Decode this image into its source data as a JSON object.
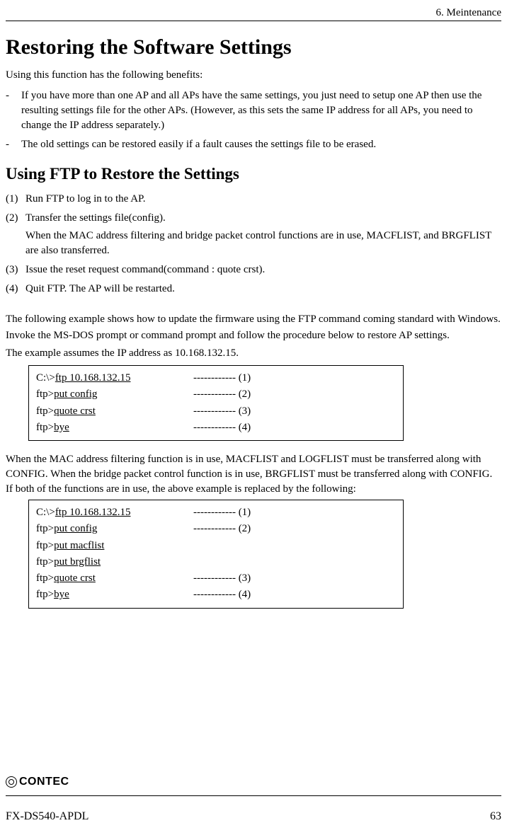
{
  "header": {
    "chapter": "6. Meintenance"
  },
  "title": "Restoring the Software Settings",
  "intro": "Using this function has the following benefits:",
  "bullets": [
    "If you have more than one AP and all APs have the same settings, you just need to setup one AP then use the resulting settings file for the other APs.  (However, as this sets the same IP address for all APs, you need to change the IP address separately.)",
    " The old settings can be restored easily if a fault causes the settings file to be erased."
  ],
  "subtitle": "Using FTP to Restore the Settings",
  "steps": [
    {
      "n": "(1)",
      "text": "Run FTP to log in to the AP."
    },
    {
      "n": "(2)",
      "text": "Transfer the settings file(config).",
      "sub": "When the MAC address filtering and bridge packet control functions are in use, MACFLIST, and BRGFLIST are also transferred."
    },
    {
      "n": "(3)",
      "text": "Issue the reset request command(command : quote crst)."
    },
    {
      "n": "(4)",
      "text": "Quit FTP.  The AP will be restarted."
    }
  ],
  "para1a": "The following example shows how to update the firmware using the FTP command coming standard with Windows.",
  "para1b": "Invoke the MS-DOS prompt or command prompt and follow the procedure below to restore AP settings.",
  "para1c": "The example assumes the IP address as 10.168.132.15.",
  "code1": [
    {
      "prompt": "C:\\>",
      "cmd": "ftp 10.168.132.15",
      "ann": "------------ (1)"
    },
    {
      "prompt": "ftp>",
      "cmd": "put config",
      "ann": "------------ (2)"
    },
    {
      "prompt": "ftp>",
      "cmd": "quote crst",
      "ann": "------------ (3)"
    },
    {
      "prompt": "ftp>",
      "cmd": "bye",
      "ann": "------------ (4)"
    }
  ],
  "between": "When the MAC address filtering function is in use, MACFLIST and LOGFLIST must be transferred along with CONFIG.  When the bridge packet control function is in use, BRGFLIST must be transferred along with CONFIG.  If both of the functions are in use, the above example is replaced by the following:",
  "code2": [
    {
      "prompt": "C:\\>",
      "cmd": "ftp 10.168.132.15",
      "ann": "------------ (1)"
    },
    {
      "prompt": "ftp>",
      "cmd": "put config",
      "ann": "------------ (2)"
    },
    {
      "prompt": "ftp>",
      "cmd": "put macflist",
      "ann": ""
    },
    {
      "prompt": "ftp>",
      "cmd": "put brgflist",
      "ann": ""
    },
    {
      "prompt": "ftp>",
      "cmd": "quote crst",
      "ann": "------------ (3)"
    },
    {
      "prompt": "ftp>",
      "cmd": "bye",
      "ann": "------------ (4)"
    }
  ],
  "footer": {
    "brand": "CONTEC",
    "model": "FX-DS540-APDL",
    "page": "63"
  }
}
